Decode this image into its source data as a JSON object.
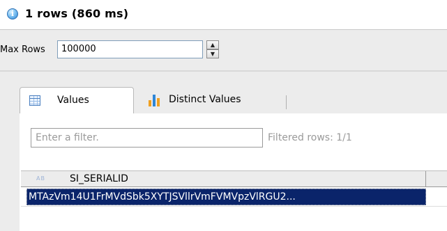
{
  "status": {
    "text": "1 rows (860 ms)",
    "icon": "info-icon"
  },
  "toolbar": {
    "max_rows_label": "Max Rows",
    "max_rows_value": "100000"
  },
  "tabs": [
    {
      "label": "Values",
      "icon": "table-grid-icon",
      "selected": true
    },
    {
      "label": "Distinct Values",
      "icon": "bar-chart-icon",
      "selected": false
    }
  ],
  "filter": {
    "placeholder": "Enter a filter.",
    "filtered_rows": "Filtered rows: 1/1"
  },
  "table": {
    "columns": [
      {
        "type_badge": "AB",
        "name": "SI_SERIALID"
      }
    ],
    "rows": [
      [
        "MTAzVm14U1FrMVdSbk5XYTJSVllrVmFVMVpzVlRGU2..."
      ]
    ]
  },
  "colors": {
    "selection": "#0a246a",
    "panel_bg": "#ececec",
    "accent_blue": "#2f86d6",
    "bar_icon_orange": "#f0a020"
  }
}
